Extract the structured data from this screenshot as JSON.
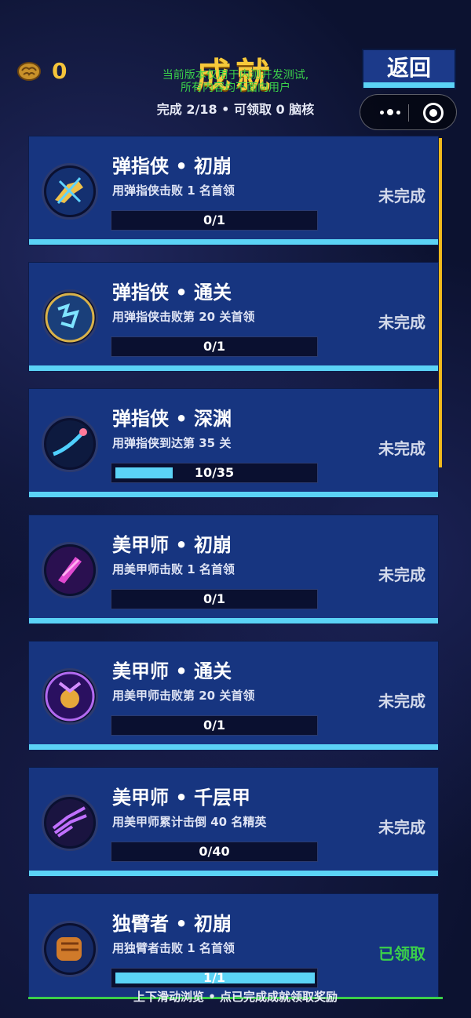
{
  "header": {
    "currency_value": "0",
    "title": "成就",
    "notice_line1": "当前版本仅用于内测开发测试,",
    "notice_line2": "所有内容均不面向用户",
    "summary": "完成 2/18 • 可领取 0 脑核",
    "back_label": "返回"
  },
  "achievements": [
    {
      "title": "弹指侠 • 初崩",
      "desc": "用弹指侠击败 1 名首领",
      "progress_text": "0/1",
      "progress_fraction": 0,
      "status": "未完成",
      "icon": "flick-hand-icon"
    },
    {
      "title": "弹指侠 • 通关",
      "desc": "用弹指侠击败第 20 关首领",
      "progress_text": "0/1",
      "progress_fraction": 0,
      "status": "未完成",
      "icon": "glyph-badge-icon"
    },
    {
      "title": "弹指侠 • 深渊",
      "desc": "用弹指侠到达第 35 关",
      "progress_text": "10/35",
      "progress_fraction": 0.2857,
      "status": "未完成",
      "icon": "comet-icon"
    },
    {
      "title": "美甲师 • 初崩",
      "desc": "用美甲师击败 1 名首领",
      "progress_text": "0/1",
      "progress_fraction": 0,
      "status": "未完成",
      "icon": "nail-blade-icon"
    },
    {
      "title": "美甲师 • 通关",
      "desc": "用美甲师击败第 20 关首领",
      "progress_text": "0/1",
      "progress_fraction": 0,
      "status": "未完成",
      "icon": "crest-medal-icon"
    },
    {
      "title": "美甲师 • 千层甲",
      "desc": "用美甲师累计击倒 40 名精英",
      "progress_text": "0/40",
      "progress_fraction": 0,
      "status": "未完成",
      "icon": "crystal-claw-icon"
    },
    {
      "title": "独臂者 • 初崩",
      "desc": "用独臂者击败 1 名首领",
      "progress_text": "1/1",
      "progress_fraction": 1,
      "status": "已领取",
      "icon": "stone-fist-icon"
    }
  ],
  "footer": {
    "hint": "上下滑动浏览 • 点已完成成就领取奖励"
  },
  "colors": {
    "accent_gold": "#f7c93a",
    "card_blue": "#173580",
    "progress_cyan": "#5bd3f6",
    "claimed_green": "#3bd04a",
    "background": "#0c1230"
  }
}
